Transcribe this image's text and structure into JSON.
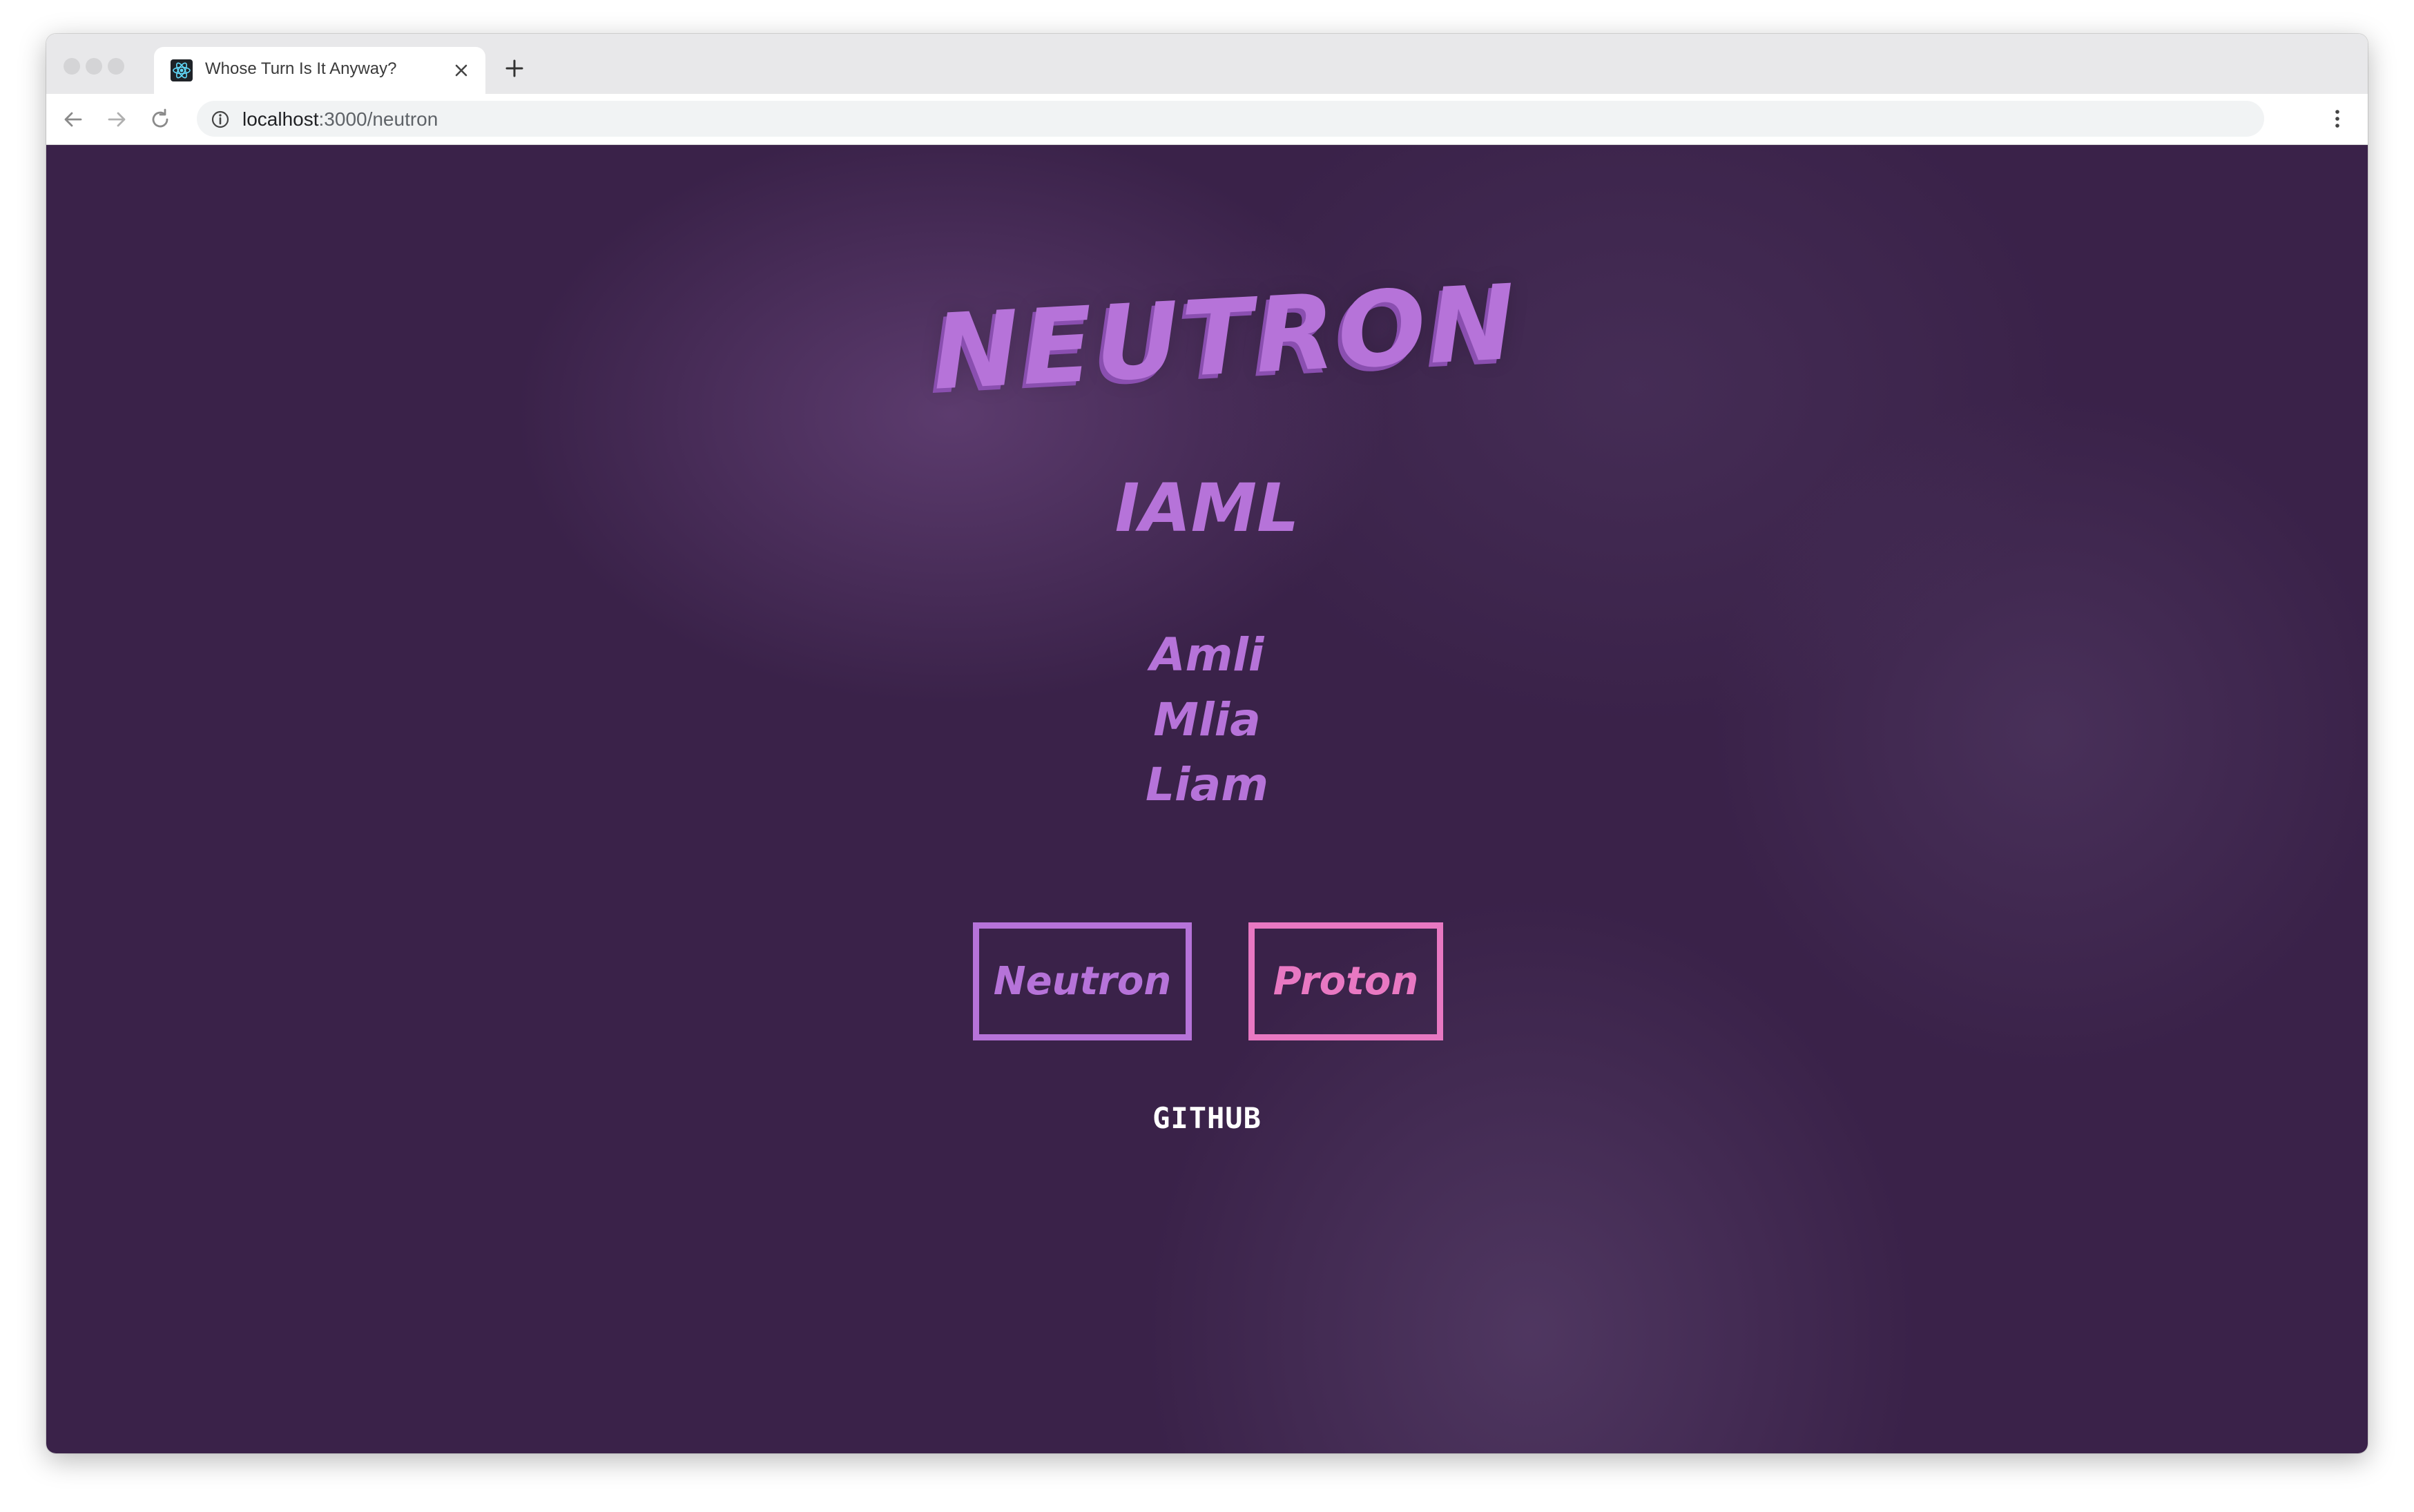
{
  "browser": {
    "tab_title": "Whose Turn Is It Anyway?",
    "url_host": "localhost",
    "url_path": ":3000/neutron",
    "icons": {
      "favicon": "react-atom-icon",
      "close": "close-icon",
      "new_tab": "plus-icon",
      "back": "arrow-left-icon",
      "forward": "arrow-right-icon",
      "reload": "reload-icon",
      "info": "info-icon",
      "bookmark": "star-icon",
      "menu": "kebab-menu-icon"
    }
  },
  "page": {
    "logo": "NEUTRON",
    "anagram": "IAML",
    "variants": [
      "Amli",
      "Mlia",
      "Liam"
    ],
    "buttons": {
      "neutron": "Neutron",
      "proton": "Proton"
    },
    "github_link": "GITHUB",
    "colors": {
      "background": "#3a2249",
      "neutron_accent": "#b673d9",
      "proton_accent": "#e878c2",
      "link": "#ffffff"
    }
  }
}
